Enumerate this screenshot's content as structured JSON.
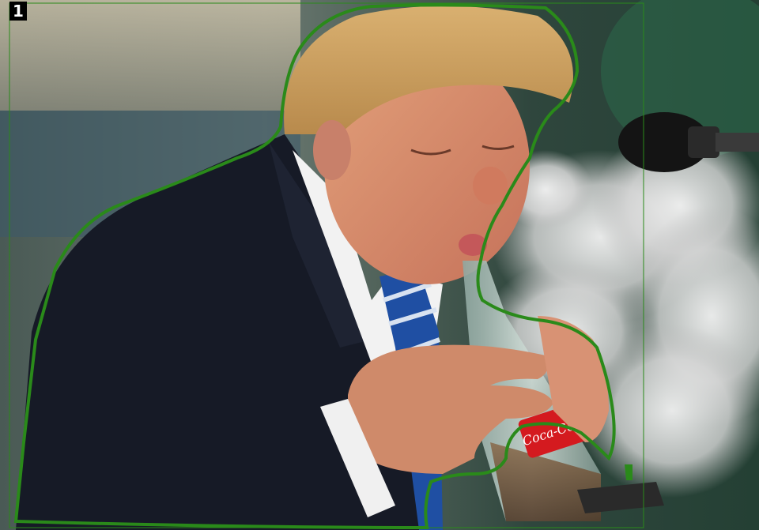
{
  "annotation": {
    "label": "1",
    "box_color": "#2a8a1a",
    "outline_color": "#2a8a1a"
  },
  "product_label": {
    "text": "Coca-Cola",
    "color": "#d41a1f"
  }
}
